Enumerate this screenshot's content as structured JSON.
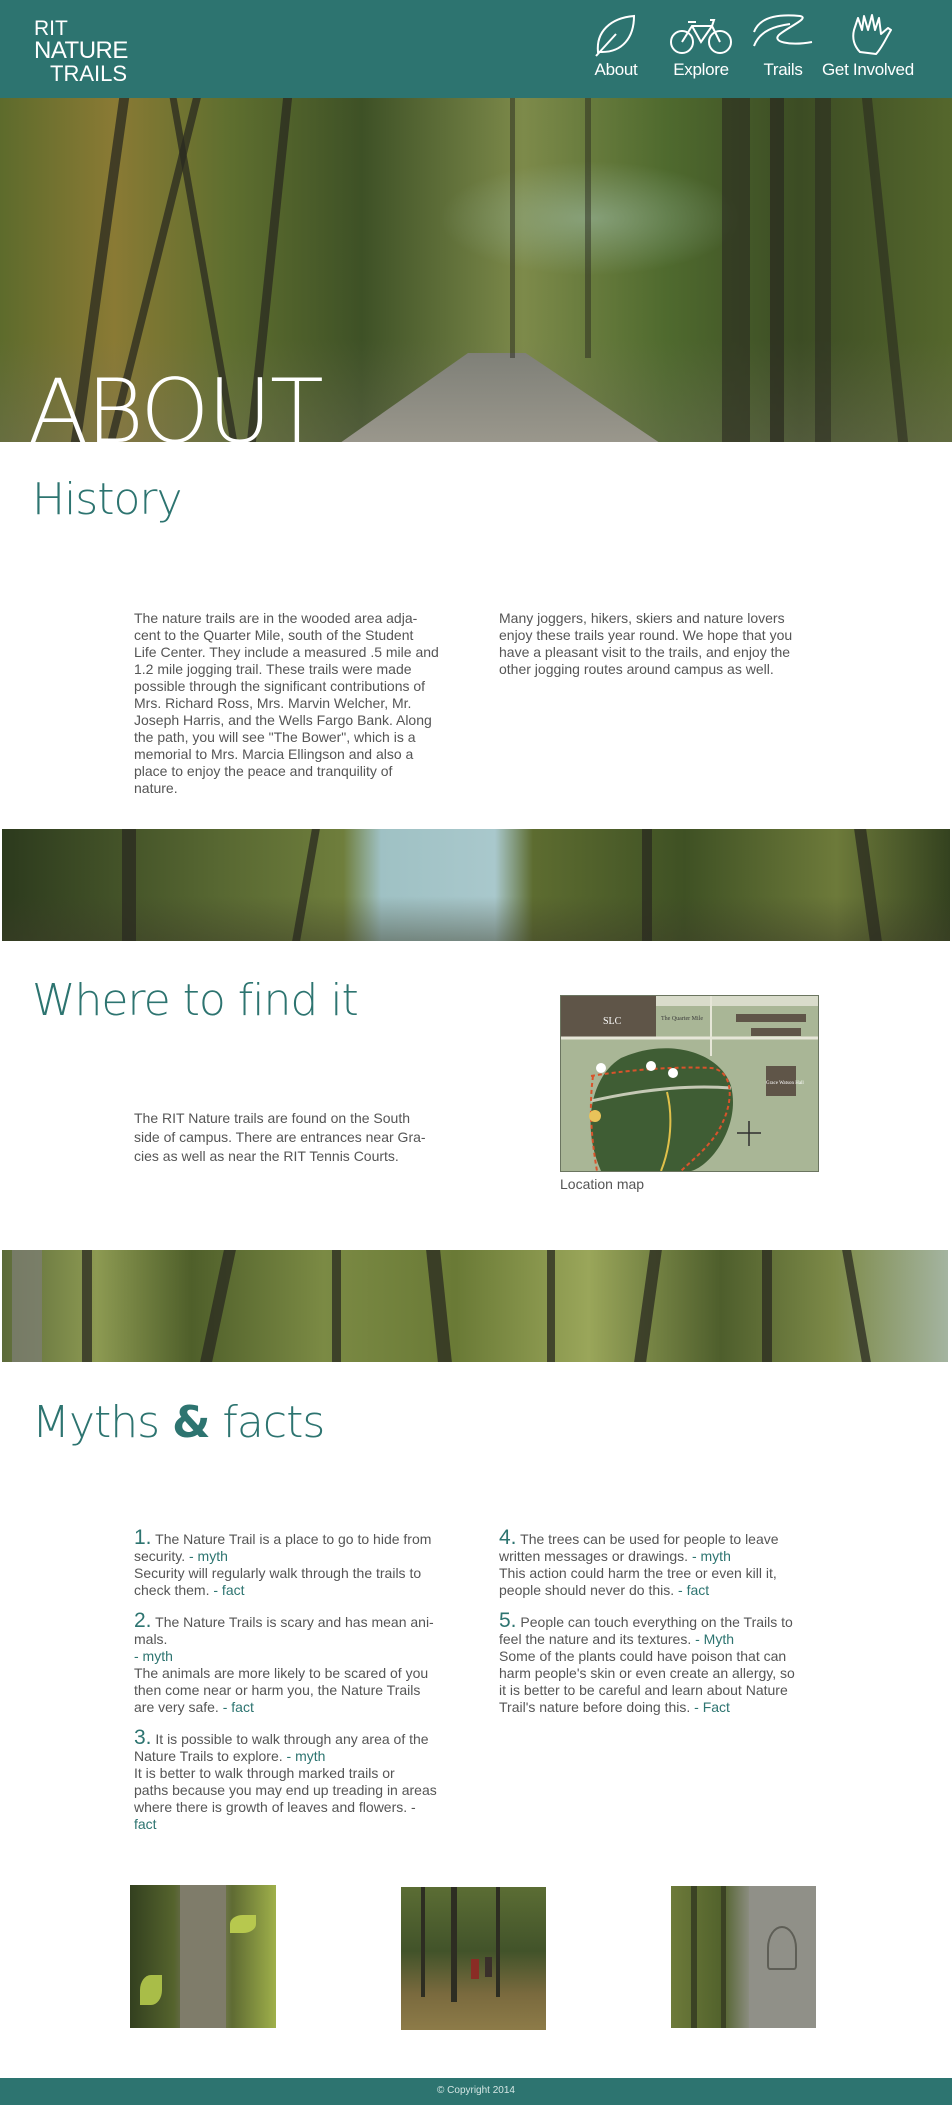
{
  "header": {
    "logo": {
      "line1": "RIT",
      "line2": "NATURE",
      "line3": "TRAILS"
    },
    "nav": [
      {
        "label": "About",
        "icon": "leaf-icon"
      },
      {
        "label": "Explore",
        "icon": "bicycle-icon"
      },
      {
        "label": "Trails",
        "icon": "trail-icon"
      },
      {
        "label": "Get Involved",
        "icon": "hand-icon"
      }
    ]
  },
  "hero": {
    "title": "ABOUT"
  },
  "history": {
    "heading": "History",
    "col1": [
      "The nature trails are in the wooded area adja-",
      "cent to the Quarter Mile, south of the Student",
      "Life Center. They include a measured .5 mile and",
      "1.2 mile jogging trail. These trails were made",
      "possible through the significant contributions of",
      "Mrs. Richard Ross, Mrs. Marvin Welcher, Mr.",
      "Joseph Harris, and the Wells Fargo Bank. Along",
      "the path, you will see \"The Bower\", which is a",
      "memorial to Mrs. Marcia Ellingson and also a",
      "place to enjoy the peace and tranquility of",
      "nature."
    ],
    "col2": [
      "Many joggers, hikers, skiers and nature lovers",
      "enjoy these trails year round. We hope that you",
      "have a pleasant visit to the trails, and enjoy the",
      "other jogging routes around campus as well."
    ]
  },
  "where": {
    "heading": "Where to find it",
    "text": [
      "The RIT Nature trails are found on the South",
      "side of campus. There are entrances near Gra-",
      "cies as well as near the RIT  Tennis Courts."
    ],
    "map_labels": {
      "slc": "SLC",
      "quarter_mile": "The Quarter Mile",
      "gracies": "Grace Watson Hall"
    },
    "map_caption": "Location map"
  },
  "myths": {
    "heading_a": "Myths ",
    "heading_amp": "&",
    "heading_b": " facts",
    "items": [
      {
        "num": "1.",
        "claim_l1": " The Nature Trail is a place to go to hide from",
        "claim_l2": "security.",
        "claim_tag": " - myth",
        "answer_lines": [
          "Security will regularly walk through the trails to"
        ],
        "answer_last": "check them.",
        "answer_tag": " - fact"
      },
      {
        "num": "2.",
        "claim_l1": " The Nature Trails is scary and has mean ani-",
        "claim_l2": "mals.",
        "claim_tag": "- myth",
        "answer_lines": [
          "The animals are more likely to be scared of you",
          "then come near or harm you, the Nature Trails"
        ],
        "answer_last": "are very safe.",
        "answer_tag": "  - fact"
      },
      {
        "num": "3.",
        "claim_l1": " It is possible to walk through any area of the",
        "claim_l2": "Nature Trails to explore.",
        "claim_tag": " - myth",
        "answer_lines": [
          "It is better to walk through marked trails or",
          "paths because you may end up treading in areas",
          "where there is growth of leaves and flowers. -"
        ],
        "answer_last": "",
        "answer_tag": "fact"
      },
      {
        "num": "4.",
        "claim_l1": " The trees can be used for people to leave",
        "claim_l2": "written messages or drawings.",
        "claim_tag": " - myth",
        "answer_lines": [
          "This action could harm the tree or even kill it,"
        ],
        "answer_last": "people should never do this.",
        "answer_tag": " - fact"
      },
      {
        "num": "5.",
        "claim_l1": " People can touch everything on the Trails to",
        "claim_l2": "feel the nature and its textures.",
        "claim_tag": " - Myth",
        "answer_lines": [
          "Some of the plants could have poison that can",
          "harm people's skin or even create an allergy, so",
          "it is better to be careful and learn about Nature"
        ],
        "answer_last": "Trail's nature before doing this.",
        "answer_tag": " - Fact"
      }
    ]
  },
  "footer": {
    "copyright": "© Copyright 2014"
  },
  "colors": {
    "brand": "#2d7470",
    "text": "#555555"
  }
}
